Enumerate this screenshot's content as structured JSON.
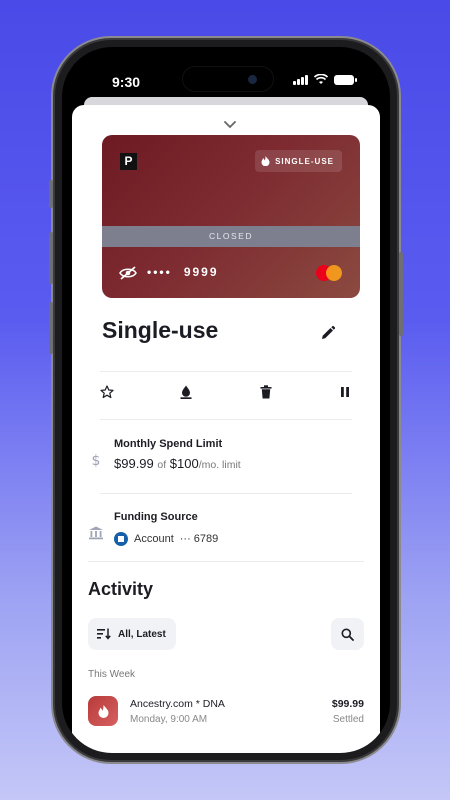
{
  "status_bar": {
    "time": "9:30"
  },
  "card": {
    "logo": "P",
    "badge_label": "SINGLE-USE",
    "state_label": "CLOSED",
    "masked_dots": "••••",
    "last4": "9999",
    "gradient_colors": [
      "#6e1a23",
      "#8b4a40"
    ]
  },
  "header": {
    "title": "Single-use"
  },
  "actions": [
    {
      "icon": "star-icon"
    },
    {
      "icon": "droplet-icon"
    },
    {
      "icon": "trash-icon"
    },
    {
      "icon": "pause-icon"
    }
  ],
  "spend_limit": {
    "label": "Monthly Spend Limit",
    "spent": "$99.99",
    "of": "of",
    "limit": "$100",
    "period": "/mo. limit"
  },
  "funding": {
    "label": "Funding Source",
    "account": "Account",
    "masked": "··· 6789"
  },
  "activity": {
    "title": "Activity",
    "filter_label": "All, Latest",
    "section_label": "This Week",
    "transactions": [
      {
        "merchant": "Ancestry.com * DNA",
        "time": "Monday, 9:00 AM",
        "amount": "$99.99",
        "status": "Settled"
      }
    ]
  },
  "colors": {
    "background_top": "#4a4ae8",
    "card": "#7d2a30",
    "closed_band": "#7d7f8e",
    "merchant_icon": "#c94a4a"
  }
}
